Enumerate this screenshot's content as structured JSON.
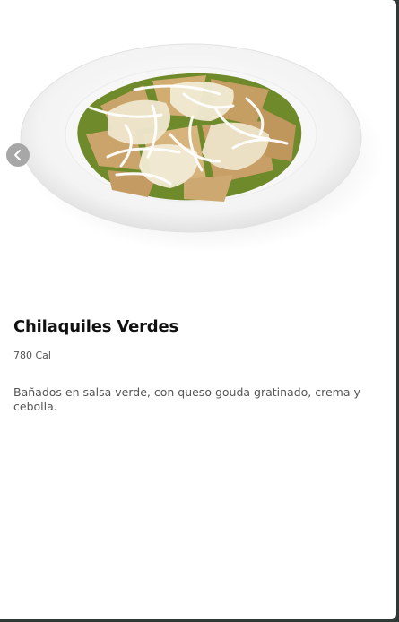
{
  "product": {
    "name": "Chilaquiles Verdes",
    "calories": "780 Cal",
    "description": "Bañados en salsa verde, con queso gouda gratinado, crema y cebolla."
  },
  "carousel": {
    "prev_icon": "chevron-left-icon"
  },
  "colors": {
    "card_background": "#ffffff",
    "page_background": "#2f3a36",
    "nav_button": "#a7a7a7",
    "title": "#111111",
    "body_text": "#555555",
    "salsa_verde": "#6f8a2a",
    "tortilla": "#c9a46a",
    "cheese": "#efe7cf"
  }
}
